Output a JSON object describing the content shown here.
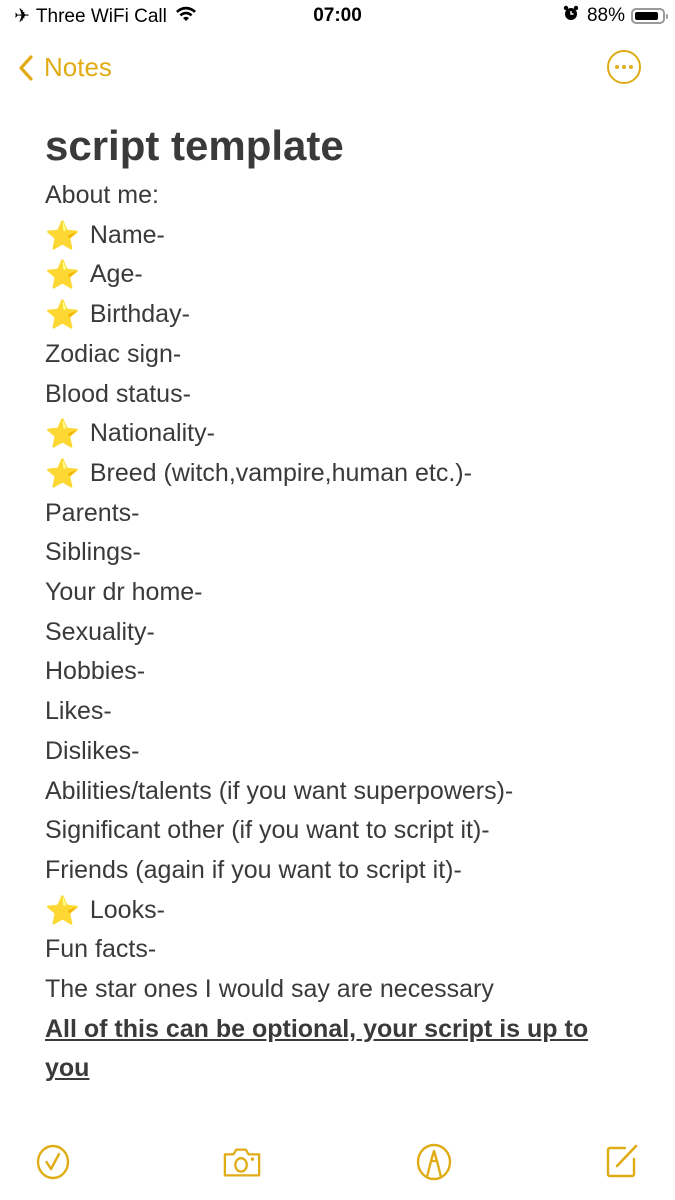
{
  "status_bar": {
    "carrier": "Three WiFi Call",
    "time": "07:00",
    "battery_percent_label": "88%",
    "battery_level": 0.88
  },
  "nav": {
    "back_label": "Notes"
  },
  "note": {
    "title": "script template",
    "lines": [
      {
        "star": false,
        "text": "About me:"
      },
      {
        "star": true,
        "text": "Name-"
      },
      {
        "star": true,
        "text": "Age-"
      },
      {
        "star": true,
        "text": "Birthday-"
      },
      {
        "star": false,
        "text": "Zodiac sign-"
      },
      {
        "star": false,
        "text": "Blood status-"
      },
      {
        "star": true,
        "text": "Nationality-"
      },
      {
        "star": true,
        "text": "Breed (witch,vampire,human etc.)-"
      },
      {
        "star": false,
        "text": "Parents-"
      },
      {
        "star": false,
        "text": "Siblings-"
      },
      {
        "star": false,
        "text": "Your dr home-"
      },
      {
        "star": false,
        "text": "Sexuality-"
      },
      {
        "star": false,
        "text": "Hobbies-"
      },
      {
        "star": false,
        "text": "Likes-"
      },
      {
        "star": false,
        "text": "Dislikes-"
      },
      {
        "star": false,
        "text": "Abilities/talents (if you want superpowers)-"
      },
      {
        "star": false,
        "text": "Significant other (if you want to script it)-"
      },
      {
        "star": false,
        "text": "Friends (again if you want to script it)-"
      },
      {
        "star": true,
        "text": "Looks-"
      },
      {
        "star": false,
        "text": "Fun facts-"
      },
      {
        "star": false,
        "text": "The star ones I would say are necessary"
      }
    ],
    "star_glyph": "⭐",
    "emphasis": "All of this can be optional, your script is up to you"
  },
  "toolbar": {
    "items": [
      "checklist",
      "camera",
      "markup",
      "compose"
    ]
  },
  "colors": {
    "accent": "#e0ac16",
    "text": "#3a3a3c"
  }
}
